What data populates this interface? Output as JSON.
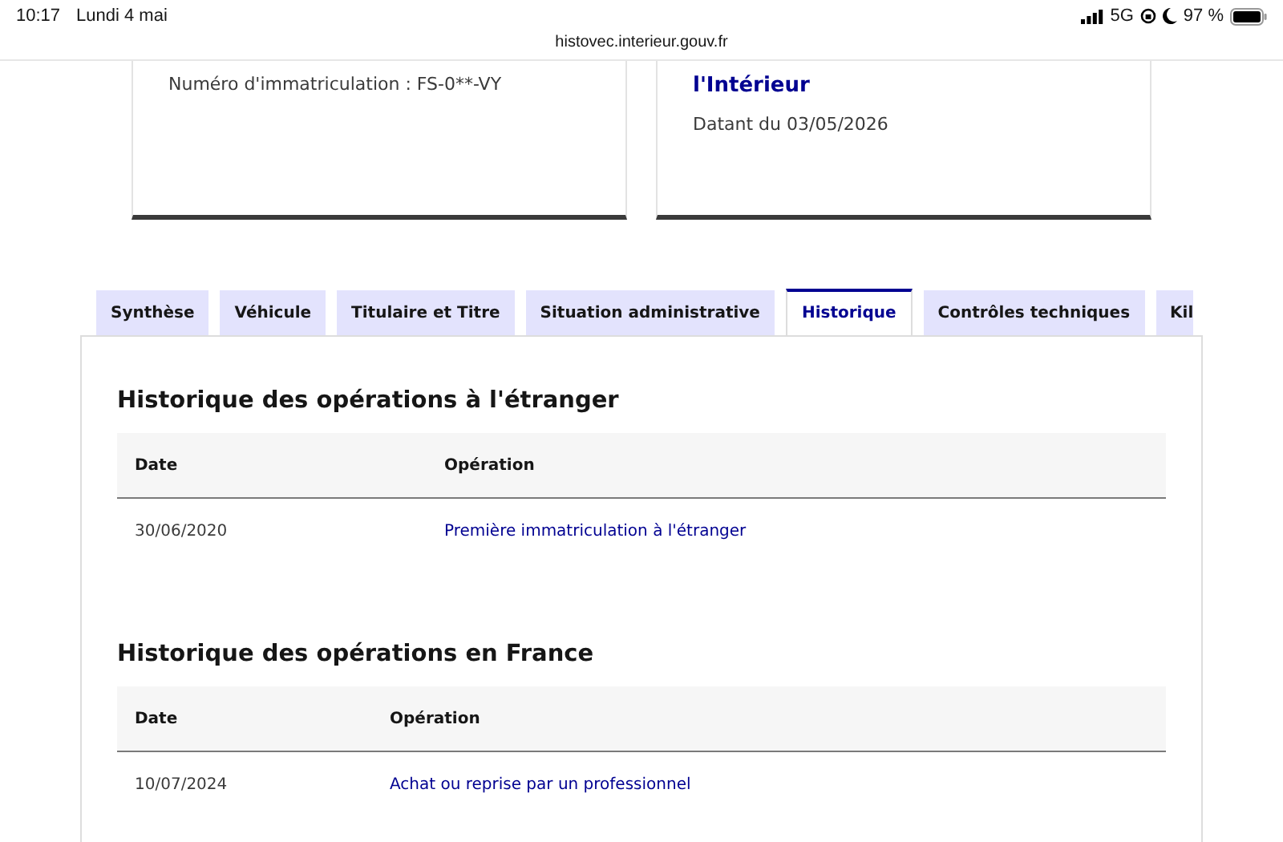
{
  "status_bar": {
    "time": "10:17",
    "date": "Lundi 4 mai",
    "network": "5G",
    "battery": "97 %"
  },
  "url": "histovec.interieur.gouv.fr",
  "cards": [
    {
      "kind": "plate",
      "text": "Numéro d'immatriculation : FS-0**-VY"
    },
    {
      "kind": "source",
      "title": "l'Intérieur",
      "text": "Datant du 03/05/2026"
    }
  ],
  "tabs": [
    {
      "label": "Synthèse",
      "selected": false
    },
    {
      "label": "Véhicule",
      "selected": false
    },
    {
      "label": "Titulaire et Titre",
      "selected": false
    },
    {
      "label": "Situation administrative",
      "selected": false
    },
    {
      "label": "Historique",
      "selected": true
    },
    {
      "label": "Contrôles techniques",
      "selected": false
    },
    {
      "label": "Kil",
      "selected": false
    }
  ],
  "sections": [
    {
      "title": "Historique des opérations à l'étranger",
      "columns": [
        "Date",
        "Opération"
      ],
      "rows": [
        {
          "date": "30/06/2020",
          "operation": "Première immatriculation à l'étranger"
        }
      ]
    },
    {
      "title": "Historique des opérations en France",
      "columns": [
        "Date",
        "Opération"
      ],
      "rows": [
        {
          "date": "10/07/2024",
          "operation": "Achat ou reprise par un professionnel"
        }
      ]
    }
  ]
}
